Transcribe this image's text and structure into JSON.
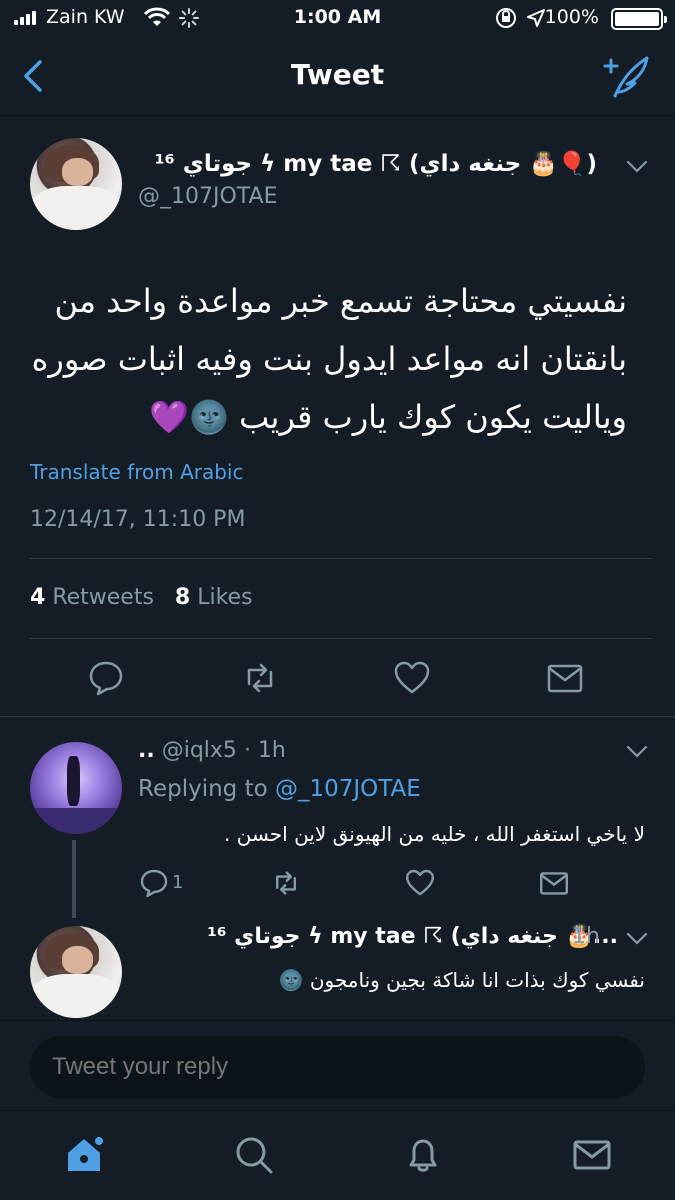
{
  "status_bar": {
    "carrier": "Zain KW",
    "time": "1:00 AM",
    "battery": "100%"
  },
  "nav": {
    "title": "Tweet"
  },
  "tweet": {
    "display_name": "جوتاي ¹⁶ ϟ my tae ☈ (جنغه داي 🎂🎈)",
    "handle": "@_107JOTAE",
    "text_lines": [
      "نفسيتي محتاجة تسمع خبر مواعدة واحد من",
      "بانقتان انه مواعد ايدول بنت وفيه اثبات صوره",
      "وياليت يكون كوك يارب قريب 🌚💜"
    ],
    "translate_label": "Translate from Arabic",
    "timestamp": "12/14/17, 11:10 PM",
    "retweets_count": "4",
    "retweets_label": "Retweets",
    "likes_count": "8",
    "likes_label": "Likes"
  },
  "replies": [
    {
      "display_name": "..",
      "handle": "@iqlx5",
      "time": "· 1h",
      "replying_prefix": "Replying to",
      "replying_to": "@_107JOTAE",
      "text": "لا ياخي استغفر الله ، خليه من الهيونق لاين احسن .",
      "reply_count": "1"
    },
    {
      "display_name": "جوتاي ¹⁶ ϟ my tae ☈ (جنغه داي 🎂...",
      "time": "1h",
      "text": "نفسي كوك بذات انا شاكة بجين ونامجون 🌚"
    }
  ],
  "reply_box": {
    "placeholder": "Tweet your reply"
  },
  "colors": {
    "background": "#141d26",
    "accent": "#4f9fe5",
    "muted": "#8899a6"
  },
  "icons": [
    "back-chevron-icon",
    "compose-tweet-icon",
    "reply-icon",
    "retweet-icon",
    "like-icon",
    "dm-icon",
    "home-icon",
    "search-icon",
    "notifications-icon",
    "messages-icon"
  ]
}
